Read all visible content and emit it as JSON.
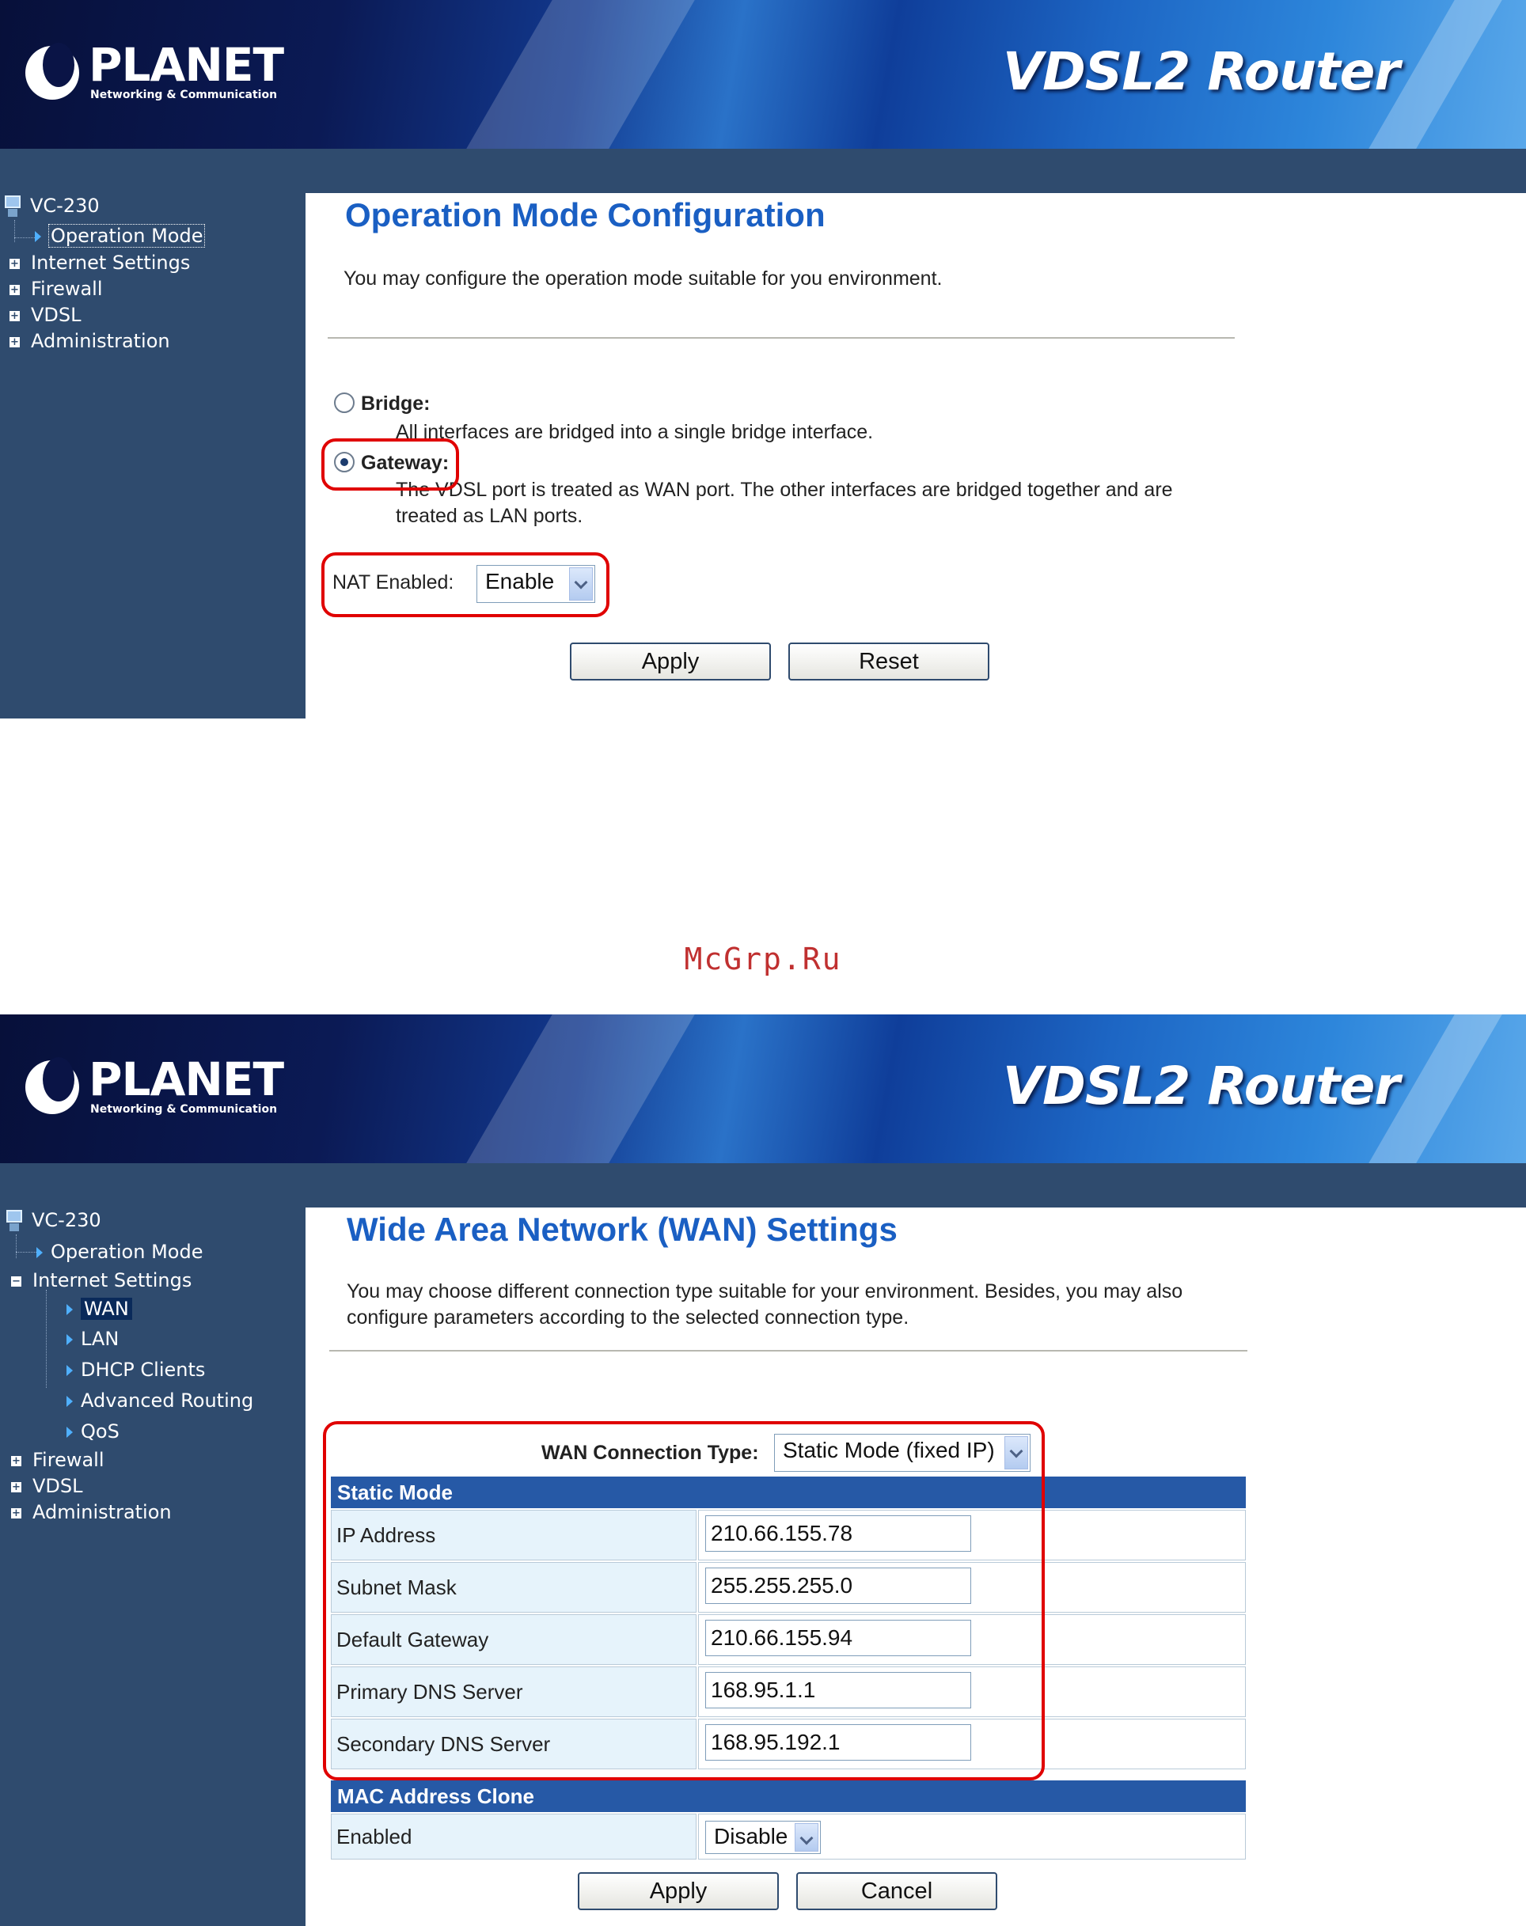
{
  "brand": {
    "logo_text": "PLANET",
    "logo_sub": "Networking & Communication",
    "product": "VDSL2 Router"
  },
  "watermark": "McGrp.Ru",
  "screen1": {
    "tree": {
      "root": "VC-230",
      "items": [
        {
          "label": "Operation Mode"
        },
        {
          "label": "Internet Settings"
        },
        {
          "label": "Firewall"
        },
        {
          "label": "VDSL"
        },
        {
          "label": "Administration"
        }
      ]
    },
    "title": "Operation Mode Configuration",
    "description": "You may configure the operation mode suitable for you environment.",
    "bridge": {
      "label": "Bridge:",
      "description": "All interfaces are bridged into a single bridge interface."
    },
    "gateway": {
      "label": "Gateway:",
      "description": "The VDSL port is treated as WAN port. The other interfaces are bridged together and are treated as LAN ports."
    },
    "nat": {
      "label": "NAT Enabled:",
      "value": "Enable"
    },
    "apply_label": "Apply",
    "reset_label": "Reset"
  },
  "screen2": {
    "tree": {
      "root": "VC-230",
      "items": [
        {
          "label": "Operation Mode"
        },
        {
          "label": "Internet Settings"
        },
        {
          "label": "WAN"
        },
        {
          "label": "LAN"
        },
        {
          "label": "DHCP Clients"
        },
        {
          "label": "Advanced Routing"
        },
        {
          "label": "QoS"
        },
        {
          "label": "Firewall"
        },
        {
          "label": "VDSL"
        },
        {
          "label": "Administration"
        }
      ]
    },
    "title": "Wide Area Network (WAN) Settings",
    "description": "You may choose different connection type suitable for your environment. Besides, you may also configure parameters according to the selected connection type.",
    "wan_type": {
      "label": "WAN Connection Type:",
      "value": "Static Mode (fixed IP)"
    },
    "static": {
      "header": "Static Mode",
      "rows": [
        {
          "label": "IP Address",
          "value": "210.66.155.78"
        },
        {
          "label": "Subnet Mask",
          "value": "255.255.255.0"
        },
        {
          "label": "Default Gateway",
          "value": "210.66.155.94"
        },
        {
          "label": "Primary DNS Server",
          "value": "168.95.1.1"
        },
        {
          "label": "Secondary DNS Server",
          "value": "168.95.192.1"
        }
      ]
    },
    "mac_clone": {
      "header": "MAC Address Clone",
      "enabled_label": "Enabled",
      "enabled_value": "Disable"
    },
    "apply_label": "Apply",
    "cancel_label": "Cancel"
  }
}
